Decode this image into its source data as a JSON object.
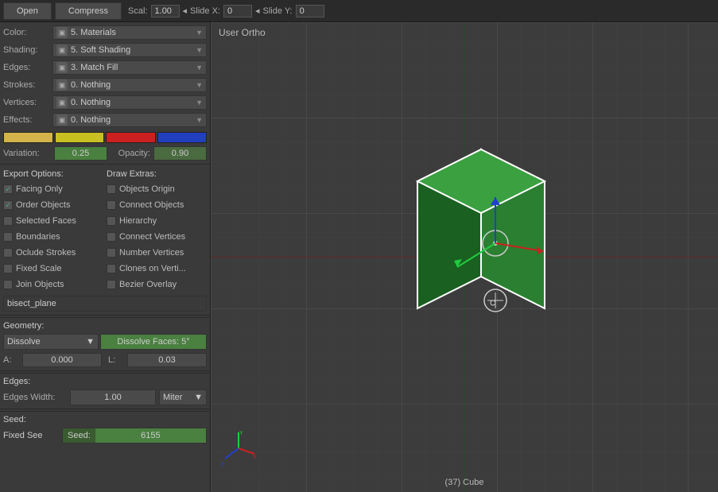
{
  "topbar": {
    "open_label": "Open",
    "compress_label": "Compress",
    "scal_label": "Scal:",
    "scal_value": "1.00",
    "slide_x_label": "Slide X:",
    "slide_x_value": "0",
    "slide_y_label": "Slide Y:",
    "slide_y_value": "0"
  },
  "viewport": {
    "view_label": "User Ortho",
    "bottom_label": "(37) Cube"
  },
  "properties": {
    "color_label": "Color:",
    "color_value": "5. Materials",
    "shading_label": "Shading:",
    "shading_value": "5. Soft Shading",
    "edges_label": "Edges:",
    "edges_value": "3. Match Fill",
    "strokes_label": "Strokes:",
    "strokes_value": "0. Nothing",
    "vertices_label": "Vertices:",
    "vertices_value": "0. Nothing",
    "effects_label": "Effects:",
    "effects_value": "0. Nothing"
  },
  "swatches": {
    "colors": [
      "#d4b44a",
      "#c8c020",
      "#cc2020",
      "#2040c0"
    ]
  },
  "variation": {
    "label": "Variation:",
    "value": "0.25",
    "opacity_label": "Opacity:",
    "opacity_value": "0.90"
  },
  "export_options": {
    "header": "Export Options:",
    "facing_only": {
      "label": "Facing Only",
      "checked": true
    },
    "order_objects": {
      "label": "Order Objects",
      "checked": true
    },
    "selected_faces": {
      "label": "Selected Faces",
      "checked": false
    },
    "boundaries": {
      "label": "Boundaries",
      "checked": false
    },
    "oclude_strokes": {
      "label": "Oclude Strokes",
      "checked": false
    },
    "fixed_scale": {
      "label": "Fixed Scale",
      "checked": false
    },
    "join_objects": {
      "label": "Join Objects",
      "checked": false
    }
  },
  "draw_extras": {
    "header": "Draw Extras:",
    "objects_origin": {
      "label": "Objects Origin",
      "checked": false
    },
    "connect_objects": {
      "label": "Connect Objects",
      "checked": false
    },
    "hierarchy": {
      "label": "Hierarchy",
      "checked": false
    },
    "connect_vertices": {
      "label": "Connect Vertices",
      "checked": false
    },
    "number_vertices": {
      "label": "Number Vertices",
      "checked": false
    },
    "clones_on_verti": {
      "label": "Clones on Verti...",
      "checked": false
    },
    "bezier_overlay": {
      "label": "Bezier Overlay",
      "checked": false
    }
  },
  "bisect": {
    "label": "bisect_plane"
  },
  "geometry": {
    "header": "Geometry:",
    "dissolve_value": "Dissolve",
    "dissolve_faces_value": "Dissolve Faces: 5°"
  },
  "al": {
    "a_label": "A:",
    "a_value": "0.000",
    "l_label": "L:",
    "l_value": "0.03"
  },
  "edges_section": {
    "header": "Edges:",
    "width_label": "Edges Width:",
    "width_value": "1.00",
    "type_value": "Miter"
  },
  "seed_section": {
    "header": "Seed:",
    "fixed_see": "Fixed See",
    "seed_label": "Seed:",
    "seed_value": "6155"
  }
}
